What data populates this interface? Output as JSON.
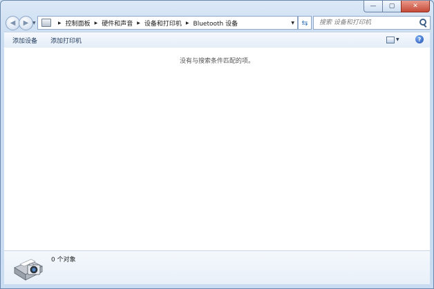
{
  "window": {
    "buttons": {
      "minimize": "—",
      "maximize": "▢",
      "close": "✕"
    }
  },
  "nav": {
    "back_icon": "back-arrow-icon",
    "forward_icon": "forward-arrow-icon"
  },
  "address": {
    "breadcrumbs": [
      "控制面板",
      "硬件和声音",
      "设备和打印机",
      "Bluetooth 设备"
    ]
  },
  "search": {
    "placeholder": "搜索 设备和打印机"
  },
  "toolbar": {
    "add_device": "添加设备",
    "add_printer": "添加打印机",
    "help": "?"
  },
  "content": {
    "empty_message": "没有与搜索条件匹配的项。"
  },
  "details": {
    "count": "0 个对象"
  },
  "colors": {
    "toolbar_text": "#1e395b",
    "accent": "#3a78c2"
  }
}
